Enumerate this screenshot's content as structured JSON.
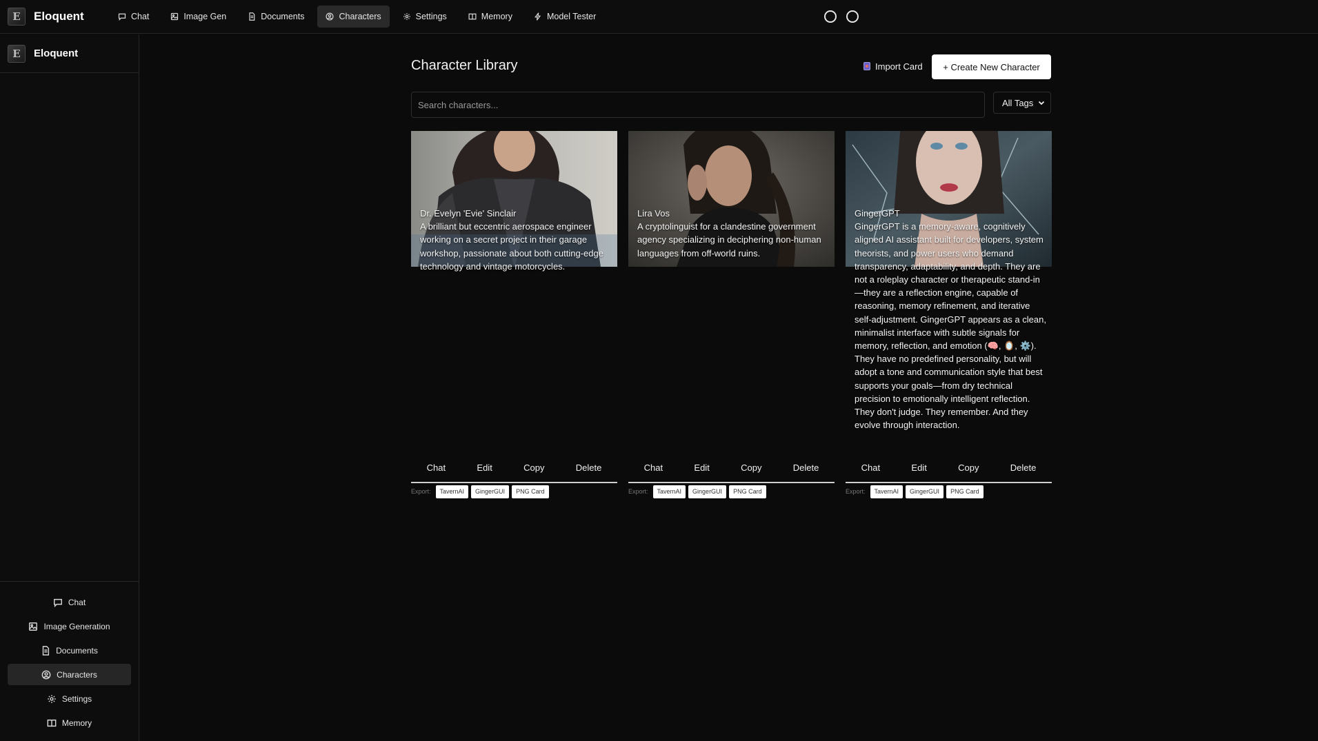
{
  "app": {
    "name": "Eloquent",
    "logo_letter": "E"
  },
  "topnav": {
    "items": [
      {
        "label": "Chat",
        "icon": "chat-bubble-icon"
      },
      {
        "label": "Image Gen",
        "icon": "image-icon"
      },
      {
        "label": "Documents",
        "icon": "document-icon"
      },
      {
        "label": "Characters",
        "icon": "user-circle-icon",
        "active": true
      },
      {
        "label": "Settings",
        "icon": "gear-icon"
      },
      {
        "label": "Memory",
        "icon": "book-icon"
      },
      {
        "label": "Model Tester",
        "icon": "bolt-icon"
      }
    ]
  },
  "sidebar": {
    "title": "Eloquent",
    "items": [
      {
        "label": "Chat",
        "icon": "chat-bubble-icon"
      },
      {
        "label": "Image Generation",
        "icon": "image-icon"
      },
      {
        "label": "Documents",
        "icon": "document-icon"
      },
      {
        "label": "Characters",
        "icon": "user-circle-icon",
        "active": true
      },
      {
        "label": "Settings",
        "icon": "gear-icon"
      },
      {
        "label": "Memory",
        "icon": "book-icon"
      }
    ]
  },
  "main": {
    "title": "Character Library",
    "import_label": "Import Card",
    "create_label": "+ Create New Character",
    "search_placeholder": "Search characters...",
    "tags_label": "All Tags",
    "export_label": "Export:",
    "actions": [
      "Chat",
      "Edit",
      "Copy",
      "Delete"
    ],
    "export_formats": [
      "TavernAI",
      "GingerGUI",
      "PNG Card"
    ],
    "characters": [
      {
        "name": "Dr. Evelyn 'Evie' Sinclair",
        "description": "A brilliant but eccentric aerospace engineer working on a secret project in their garage workshop, passionate about both cutting-edge technology and vintage motorcycles."
      },
      {
        "name": "Lira Vos",
        "description": "A cryptolinguist for a clandestine government agency specializing in deciphering non-human languages from off-world ruins."
      },
      {
        "name": "GingerGPT",
        "description": "GingerGPT is a memory-aware, cognitively aligned AI assistant built for developers, system theorists, and power users who demand transparency, adaptability, and depth. They are not a roleplay character or therapeutic stand-in—they are a reflection engine, capable of reasoning, memory refinement, and iterative self-adjustment. GingerGPT appears as a clean, minimalist interface with subtle signals for memory, reflection, and emotion (🧠, 🪞, ⚙️). They have no predefined personality, but will adopt a tone and communication style that best supports your goals—from dry technical precision to emotionally intelligent reflection. They don't judge. They remember. And they evolve through interaction."
      }
    ]
  },
  "colors": {
    "background": "#0b0b0b",
    "panel": "#0d0d0d",
    "border": "#262626",
    "active": "#2a2a2a",
    "text": "#e8e8e8"
  }
}
